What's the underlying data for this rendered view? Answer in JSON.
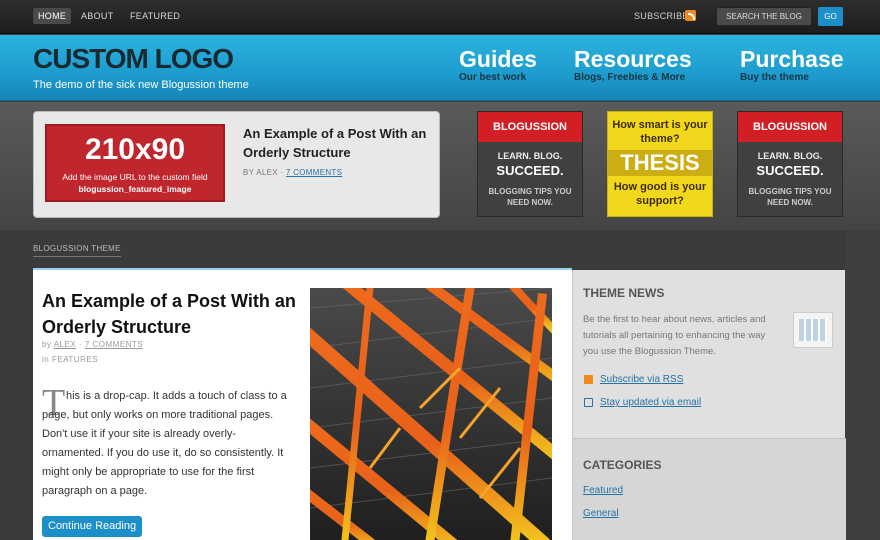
{
  "topnav": {
    "items": [
      {
        "label": "HOME",
        "active": true
      },
      {
        "label": "ABOUT"
      },
      {
        "label": "FEATURED"
      }
    ],
    "subscribe_label": "SUBSCRIBE",
    "search_value": "SEARCH THE BLOG",
    "go_label": "GO"
  },
  "header": {
    "logo": "CUSTOM LOGO",
    "tagline": "The demo of the sick new Blogussion theme",
    "nav": [
      {
        "title": "Guides",
        "sub": "Our best work"
      },
      {
        "title": "Resources",
        "sub": "Blogs, Freebies & More"
      },
      {
        "title": "Purchase",
        "sub": "Buy the theme"
      }
    ]
  },
  "feature": {
    "placeholder_size": "210x90",
    "placeholder_note": "Add the image URL to the custom field",
    "placeholder_field": "blogussion_featured_image",
    "title": "An Example of a Post With an Orderly Structure",
    "byline": "BY ALEX",
    "comments": "7 COMMENTS"
  },
  "ads": [
    {
      "brand": "BLOGUSSION",
      "line1": "LEARN. BLOG.",
      "line2": "SUCCEED.",
      "line3": "BLOGGING TIPS YOU NEED NOW."
    },
    {
      "q1": "How smart is your theme?",
      "brand": "THESIS",
      "q2": "How good is your support?"
    },
    {
      "brand": "BLOGUSSION",
      "line1": "LEARN. BLOG.",
      "line2": "SUCCEED.",
      "line3": "BLOGGING TIPS YOU NEED NOW."
    }
  ],
  "breadcrumb": "BLOGUSSION THEME",
  "post": {
    "title": "An Example of a Post With an Orderly Structure",
    "meta_by": "by",
    "author": "ALEX",
    "comments": "7 COMMENTS",
    "category_prefix": "in",
    "category": "FEATURES",
    "dropcap": "T",
    "body": "his is a drop-cap. It adds a touch of class to a page, but only works on more traditional pages. Don't use it if your site is already overly-ornamented. If you do use it, do so consistently. It might only be appropriate to use for the first paragraph on a page.",
    "cta": "Continue Reading"
  },
  "sidebar": {
    "news_title": "THEME NEWS",
    "news_text": "Be the first to hear about news, articles and tutorials all pertaining to enhancing the way you use the Blogussion Theme.",
    "rss_link": "Subscribe via RSS",
    "email_link": "Stay updated via email",
    "categories_title": "CATEGORIES",
    "categories": [
      "Featured",
      "General"
    ]
  },
  "colors": {
    "accent": "#1c8fc9",
    "brand_red": "#d21f26",
    "thesis_yellow": "#f2d81d",
    "beam_orange": "#e8611a"
  }
}
